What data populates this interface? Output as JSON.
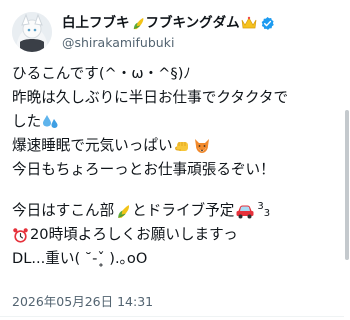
{
  "author": {
    "display_name": "白上フブキ",
    "display_name_suffix": "フブキングダム",
    "handle": "@shirakamifubuki"
  },
  "tweet": {
    "line1": "ひるこんです(^・ω・^§)ﾉ",
    "line2": "昨晩は久しぶりに半日お仕事でクタクタで",
    "line3": "した",
    "line4": "爆速睡眠で元気いっぱい",
    "line5": "今日もちょろーっとお仕事頑張るぞい！",
    "line6_a": "今日はすこん部",
    "line6_b": "とドライブ予定",
    "line6_sup": "3",
    "line6_sub": "3",
    "line7": "20時頃よろしくお願いしますっ",
    "line8": "DL...重い( ˘-ˇ̥ ).｡oO"
  },
  "timestamp": "2026年05月26日 14:31",
  "icons": [
    "avatar",
    "corn-emoji",
    "crown-emoji",
    "verified-badge-icon",
    "sweat-drops-emoji",
    "fist-emoji",
    "fox-emoji",
    "car-emoji",
    "alarm-clock-emoji"
  ],
  "colors": {
    "text": "#0f1419",
    "muted": "#536471",
    "verified": "#1d9bf0"
  }
}
